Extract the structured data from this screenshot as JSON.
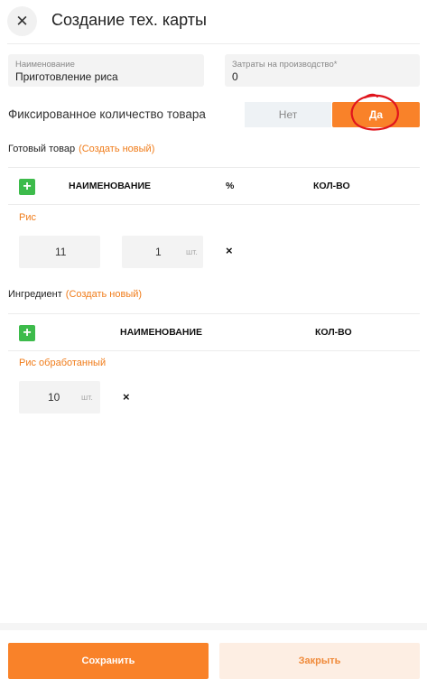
{
  "header": {
    "close_glyph": "✕",
    "title": "Создание тех. карты"
  },
  "fields": {
    "name": {
      "label": "Наименование",
      "value": "Приготовление риса"
    },
    "cost": {
      "label": "Затраты на производство*",
      "value": "0"
    }
  },
  "fixed_quantity": {
    "label": "Фиксированное количество товара",
    "no": "Нет",
    "yes": "Да",
    "selected": "Да"
  },
  "finished": {
    "label": "Готовый товар",
    "create_link": "(Создать новый)",
    "plus": "+",
    "columns": [
      "НАИМЕНОВАНИЕ",
      "%",
      "КОЛ-ВО"
    ],
    "item": {
      "name": "Рис",
      "percent": "11",
      "qty": "1",
      "unit": "шт.",
      "remove": "×"
    }
  },
  "ingredients": {
    "label": "Ингредиент",
    "create_link": "(Создать новый)",
    "plus": "+",
    "columns": [
      "НАИМЕНОВАНИЕ",
      "КОЛ-ВО"
    ],
    "item": {
      "name": "Рис обработанный",
      "qty": "10",
      "unit": "шт.",
      "remove": "×"
    }
  },
  "footer": {
    "save": "Сохранить",
    "close": "Закрыть"
  },
  "colors": {
    "accent": "#f98229",
    "link": "#f07c1a",
    "add": "#3dbb4b",
    "annotation": "#e0151d"
  }
}
